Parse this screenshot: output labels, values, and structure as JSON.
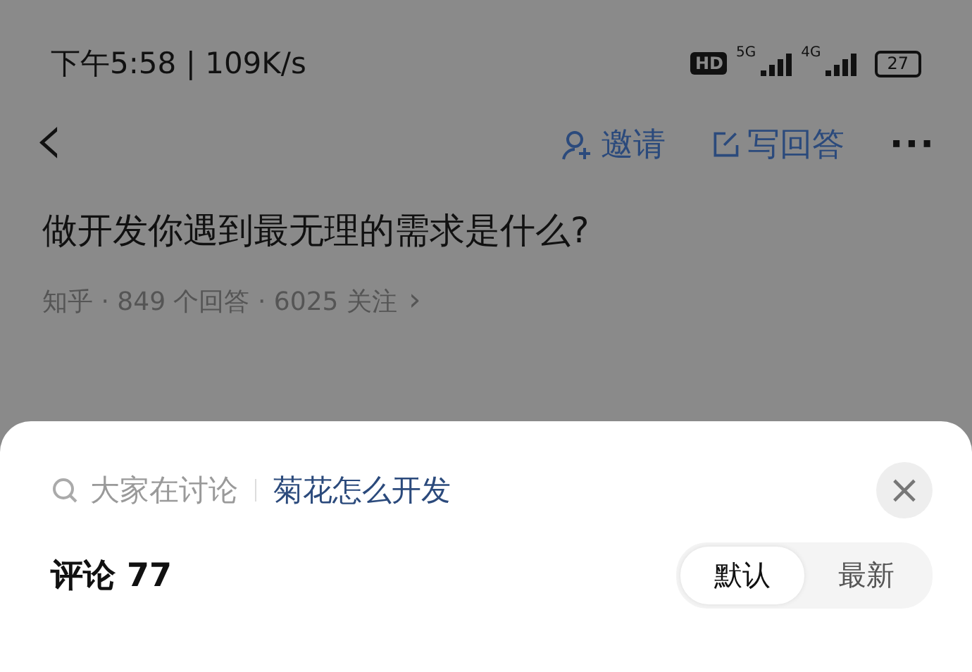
{
  "status_bar": {
    "time": "下午5:58 | 109K/s",
    "hd": "HD",
    "network_1": "5G",
    "network_2": "4G",
    "battery": "27"
  },
  "nav": {
    "back": "‹",
    "actions": [
      {
        "kind": "invite",
        "label": "邀请"
      },
      {
        "kind": "answer",
        "label": "写回答"
      }
    ],
    "more": "···"
  },
  "question": {
    "title": "做开发你遇到最无理的需求是什么?",
    "meta": "知乎 · 849 个回答 · 6025 关注",
    "chevron": "›"
  },
  "sheet": {
    "search": {
      "placeholder": "大家在讨论",
      "suggestion": "菊花怎么开发"
    },
    "close": "×",
    "comments": {
      "title": "评论 77"
    },
    "sort_tabs": [
      {
        "label": "默认",
        "selected": true
      },
      {
        "label": "最新",
        "selected": false
      }
    ]
  }
}
